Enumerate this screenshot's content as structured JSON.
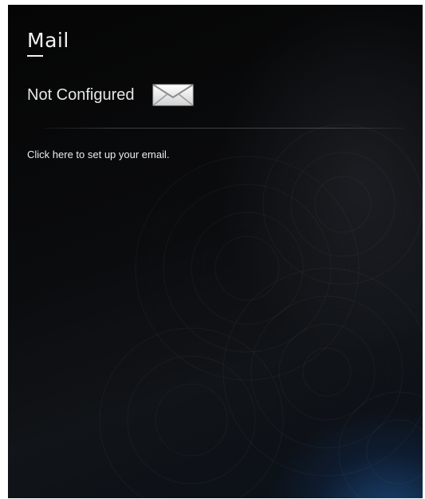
{
  "mail_tile": {
    "title": "Mail",
    "status": "Not Configured",
    "status_icon": "envelope-icon",
    "setup_link": "Click here to set up your email."
  },
  "colors": {
    "background": "#0a0b0d",
    "text": "#ececec",
    "accent_glow": "#286ebe"
  }
}
